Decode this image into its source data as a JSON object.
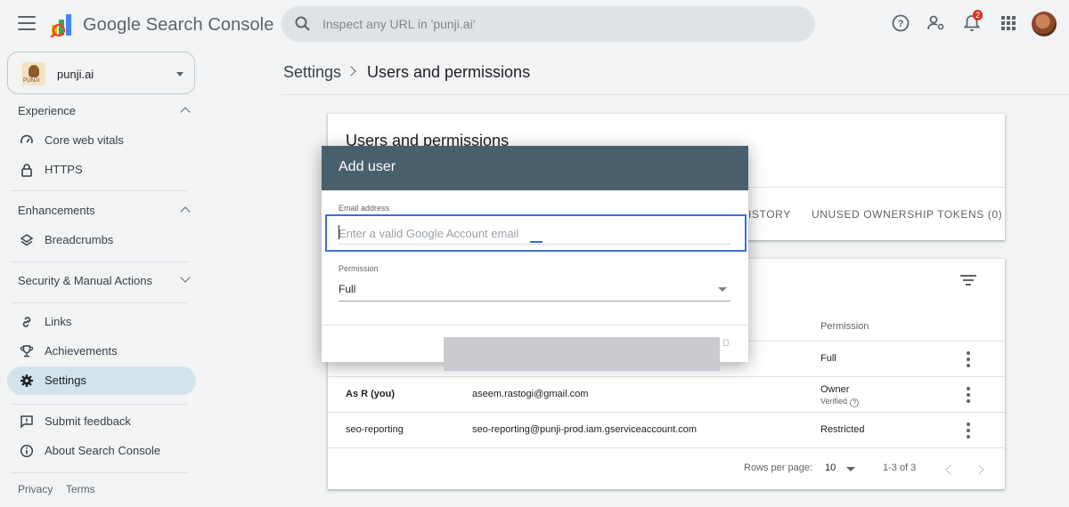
{
  "app": {
    "product_name": "Google Search Console",
    "search_placeholder": "Inspect any URL in 'punji.ai'",
    "notification_count": "2",
    "icons": [
      "menu-icon",
      "search-icon",
      "help-icon",
      "manage-accounts-icon",
      "notifications-icon",
      "apps-icon"
    ]
  },
  "property": {
    "name": "punji.ai"
  },
  "sidebar": {
    "experience": {
      "label": "Experience",
      "items": [
        {
          "label": "Core web vitals",
          "icon": "speed-icon"
        },
        {
          "label": "HTTPS",
          "icon": "lock-icon"
        }
      ]
    },
    "enhancements": {
      "label": "Enhancements",
      "items": [
        {
          "label": "Breadcrumbs",
          "icon": "layers-icon"
        }
      ]
    },
    "security": {
      "label": "Security & Manual Actions"
    },
    "misc": [
      {
        "label": "Links",
        "icon": "link-icon"
      },
      {
        "label": "Achievements",
        "icon": "trophy-icon"
      },
      {
        "label": "Settings",
        "icon": "gear-icon",
        "active": true
      }
    ],
    "bottom": [
      {
        "label": "Submit feedback",
        "icon": "feedback-icon"
      },
      {
        "label": "About Search Console",
        "icon": "info-icon"
      }
    ],
    "footer": {
      "privacy": "Privacy",
      "terms": "Terms"
    }
  },
  "breadcrumb": {
    "parent": "Settings",
    "current": "Users and permissions"
  },
  "card": {
    "title": "Users and permissions",
    "tabs": [
      "ISTORY",
      "UNUSED OWNERSHIP TOKENS (0)"
    ]
  },
  "table": {
    "headers": {
      "permission": "Permission"
    },
    "rows": [
      {
        "name": "",
        "email": "",
        "permission": "Full"
      },
      {
        "name": "As R (you)",
        "email": "aseem.rastogi@gmail.com",
        "permission": "Owner",
        "sub": "Verified"
      },
      {
        "name": "seo-reporting",
        "email": "seo-reporting@punji-prod.iam.gserviceaccount.com",
        "permission": "Restricted"
      }
    ],
    "pagination": {
      "rows_per_page_label": "Rows per page:",
      "rows_per_page": "10",
      "range": "1-3 of 3"
    }
  },
  "dialog": {
    "title": "Add user",
    "email_label": "Email address",
    "email_placeholder": "Enter a valid Google Account email",
    "email_value": "",
    "permission_label": "Permission",
    "permission_value": "Full",
    "add_button_partial": "D"
  },
  "colors": {
    "dialog_header": "#4a5f6c",
    "focus_border": "#3b6fd4",
    "active_nav": "#d3e3ec",
    "badge": "#d93025"
  }
}
